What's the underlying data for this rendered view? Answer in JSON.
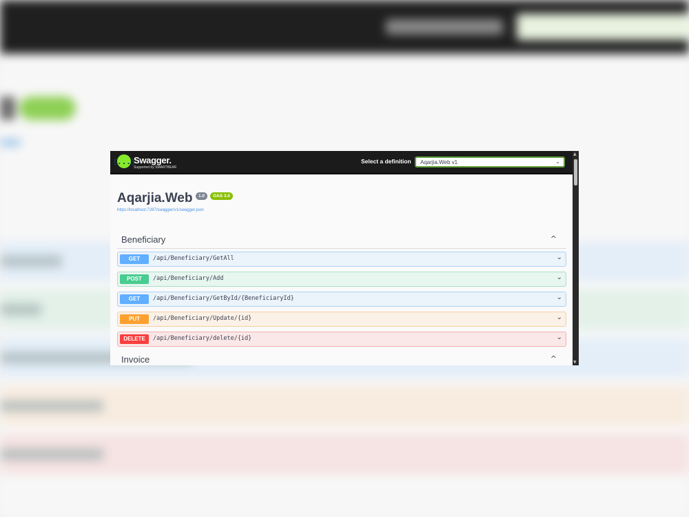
{
  "topbar": {
    "logo_icon": "{...}",
    "logo_text": "Swagger.",
    "logo_sub": "Supported by SMARTBEAR",
    "select_label": "Select a definition",
    "select_value": "Aqarjia.Web v1",
    "select_chevron": "⌄"
  },
  "info": {
    "title": "Aqarjia.Web",
    "version": "1.0",
    "oas": "OAS 3.0",
    "url": "https://localhost:7287/swagger/v1/swagger.json"
  },
  "scrollbar": {
    "up": "▲",
    "down": "▼"
  },
  "tags": [
    {
      "name": "Beneficiary",
      "chevron": "^",
      "operations": [
        {
          "method": "GET",
          "path": "/api/Beneficiary/GetAll",
          "chevron": "⌄"
        },
        {
          "method": "POST",
          "path": "/api/Beneficiary/Add",
          "chevron": "⌄"
        },
        {
          "method": "GET",
          "path": "/api/Beneficiary/GetById/{BeneficiaryId}",
          "chevron": "⌄"
        },
        {
          "method": "PUT",
          "path": "/api/Beneficiary/Update/{id}",
          "chevron": "⌄"
        },
        {
          "method": "DELETE",
          "path": "/api/Beneficiary/delete/{id}",
          "chevron": "⌄"
        }
      ]
    },
    {
      "name": "Invoice",
      "chevron": "^"
    }
  ],
  "colors": {
    "get": "#61affe",
    "get_bg": "#ebf3fb",
    "get_border": "#afd2f5",
    "post": "#49cc90",
    "post_bg": "#e8f6f0",
    "post_border": "#a8e0c6",
    "put": "#fca130",
    "put_bg": "#fbf1e6",
    "put_border": "#f5d0a5",
    "delete": "#f93e3e",
    "delete_bg": "#fae7e7",
    "delete_border": "#f3b0b0",
    "swagger_green": "#85ea2d"
  }
}
